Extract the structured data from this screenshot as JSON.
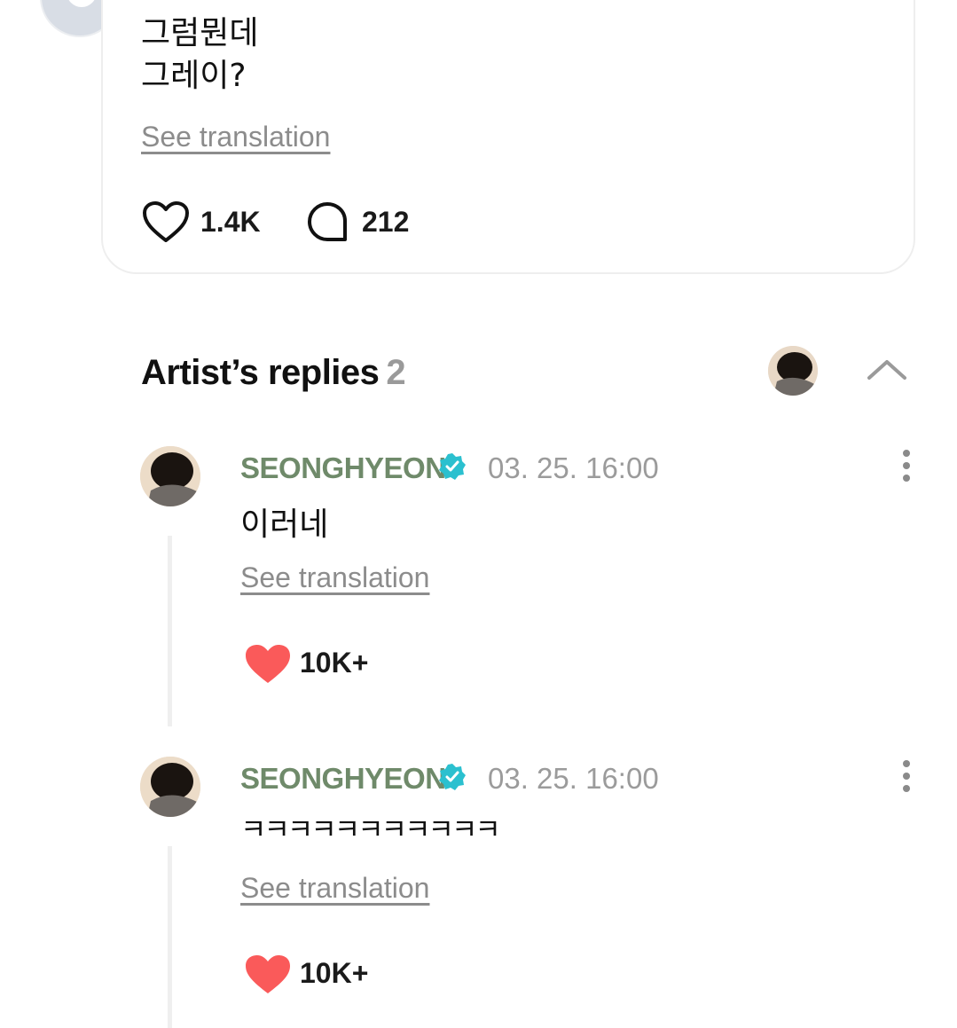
{
  "post": {
    "text_line1": "그럼뭔데",
    "text_line2": "그레이?",
    "see_translation": "See translation",
    "likes": "1.4K",
    "comments": "212"
  },
  "artist_replies": {
    "title": "Artist’s replies",
    "count": "2"
  },
  "replies": [
    {
      "author": "SEONGHYEON",
      "timestamp": "03. 25. 16:00",
      "text": "이러네",
      "see_translation": "See translation",
      "likes": "10K+"
    },
    {
      "author": "SEONGHYEON",
      "timestamp": "03. 25. 16:00",
      "text": "ㅋㅋㅋㅋㅋㅋㅋㅋㅋㅋㅋ",
      "see_translation": "See translation",
      "likes": "10K+"
    }
  ],
  "colors": {
    "author_name": "#6f8a6a",
    "verified_badge": "#2bc0cf",
    "liked_heart": "#fa5a5a",
    "muted_text": "#9b9b9b"
  },
  "icons": {
    "like": "heart-outline-icon",
    "comment": "speech-bubble-icon",
    "collapse": "chevron-up-icon",
    "verified": "verified-badge-icon",
    "liked": "heart-filled-icon",
    "more": "more-vertical-icon"
  }
}
